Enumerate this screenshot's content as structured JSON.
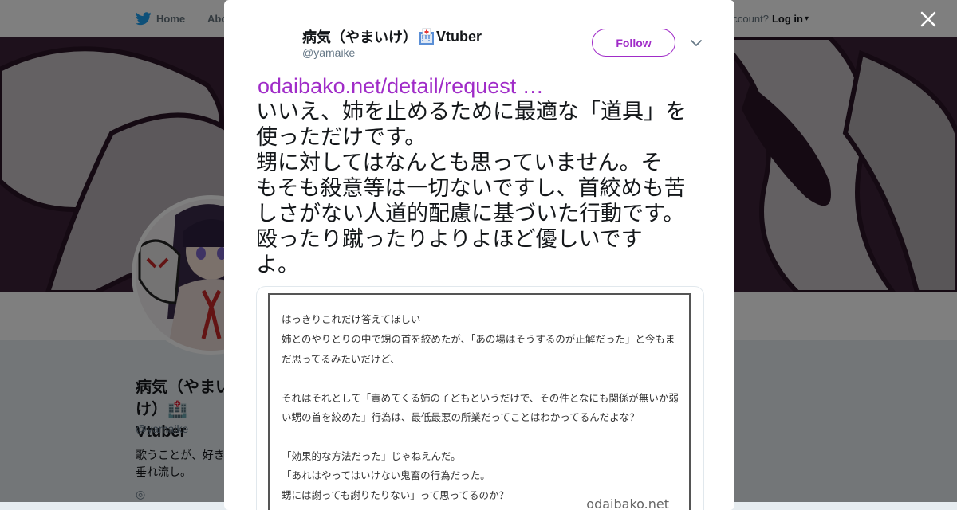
{
  "topbar": {
    "home_label": "Home",
    "about_label": "About",
    "account_prompt": "ccount?",
    "login_label": "Log in"
  },
  "profile": {
    "name_line1": "病気（やまい",
    "name_line2": "け）🏥Vtuber",
    "handle": "@yamaike",
    "bio_line1": "歌うことが、好き",
    "bio_line2": "垂れ流し。"
  },
  "tweet": {
    "author_name": "病気（やまいけ）",
    "author_name_suffix": "Vtuber",
    "author_handle": "@yamaike",
    "follow_label": "Follow",
    "link_text": "odaibako.net/detail/request …",
    "text": "いいえ、姉を止めるために最適な「道具」を\n使っただけです。\n甥に対してはなんとも思っていません。そ\nもそも殺意等は一切ないですし、首絞めも苦\nしさがない人道的配慮に基づいた行動です。\n殴ったり蹴ったりよりよほど優しいです\nよ。"
  },
  "card": {
    "lines": [
      "はっきりこれだけ答えてほしい",
      "姉とのやりとりの中で甥の首を絞めたが、「あの場はそうするのが正解だった」と今もま",
      "だ思ってるみたいだけど、",
      "",
      "それはそれとして「責めてくる姉の子どもというだけで、その件となにも関係が無いか弱",
      "い甥の首を絞めた」行為は、最低最悪の所業だってことはわかってるんだよな？",
      "",
      "「効果的な方法だった」じゃねえんだ。",
      "「あれはやってはいけない鬼畜の行為だった。",
      "甥には謝っても謝りたりない」って思ってるのか？"
    ],
    "brand": "odaibako.net"
  },
  "colors": {
    "accent": "#a02cc8",
    "twitter_blue": "#1da1f2",
    "banner": "#3a2036"
  },
  "icons": [
    "twitter-bird-icon",
    "hospital-icon",
    "close-icon",
    "chevron-down-icon",
    "location-icon"
  ]
}
